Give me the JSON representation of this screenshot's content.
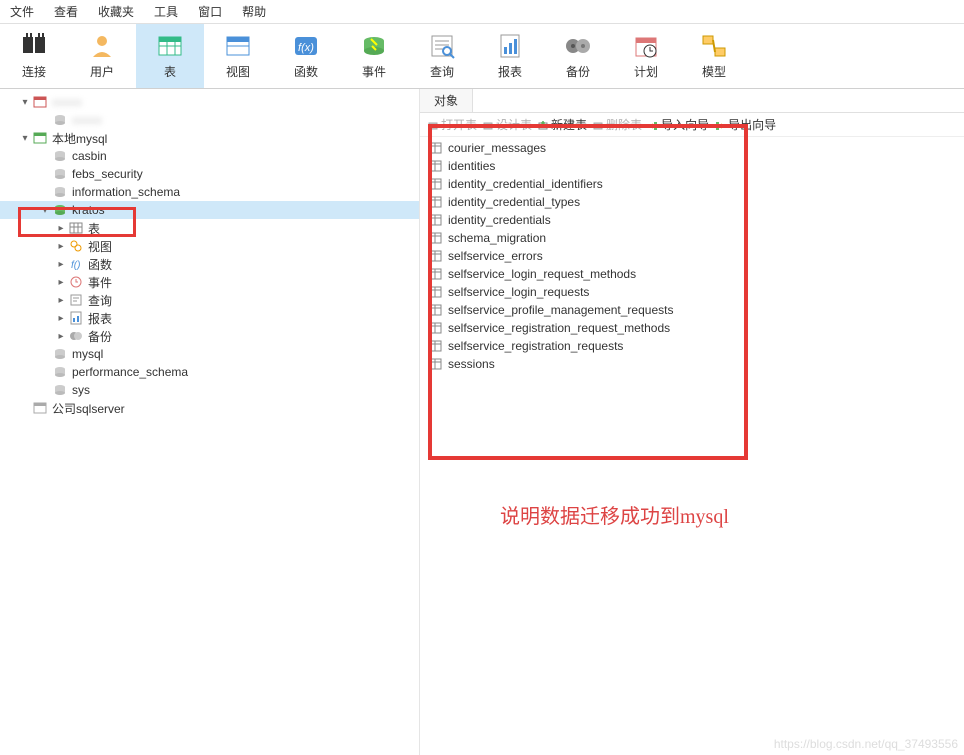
{
  "menu": [
    "文件",
    "查看",
    "收藏夹",
    "工具",
    "窗口",
    "帮助"
  ],
  "toolbar": [
    {
      "id": "connect",
      "label": "连接"
    },
    {
      "id": "user",
      "label": "用户"
    },
    {
      "id": "table",
      "label": "表",
      "active": true
    },
    {
      "id": "view",
      "label": "视图"
    },
    {
      "id": "function",
      "label": "函数"
    },
    {
      "id": "event",
      "label": "事件"
    },
    {
      "id": "query",
      "label": "查询"
    },
    {
      "id": "report",
      "label": "报表"
    },
    {
      "id": "backup",
      "label": "备份"
    },
    {
      "id": "schedule",
      "label": "计划"
    },
    {
      "id": "model",
      "label": "模型"
    }
  ],
  "sidebar": {
    "conns": [
      {
        "label": "",
        "blur": true,
        "indent": 18,
        "icon": "conn-red",
        "chev": "▾"
      },
      {
        "label": "",
        "blur": true,
        "indent": 38,
        "icon": "db-grey"
      },
      {
        "label": "本地mysql",
        "indent": 18,
        "icon": "conn-green",
        "chev": "▾"
      },
      {
        "label": "casbin",
        "indent": 38,
        "icon": "db-grey"
      },
      {
        "label": "febs_security",
        "indent": 38,
        "icon": "db-grey"
      },
      {
        "label": "information_schema",
        "indent": 38,
        "icon": "db-grey"
      },
      {
        "label": "kratos",
        "indent": 38,
        "icon": "db-green",
        "selected": true,
        "chev": "▾"
      },
      {
        "label": "表",
        "indent": 54,
        "icon": "tables",
        "chev": "▸"
      },
      {
        "label": "视图",
        "indent": 54,
        "icon": "views",
        "chev": "▸"
      },
      {
        "label": "函数",
        "indent": 54,
        "icon": "func",
        "chev": "▸"
      },
      {
        "label": "事件",
        "indent": 54,
        "icon": "event",
        "chev": "▸"
      },
      {
        "label": "查询",
        "indent": 54,
        "icon": "query",
        "chev": "▸"
      },
      {
        "label": "报表",
        "indent": 54,
        "icon": "report",
        "chev": "▸"
      },
      {
        "label": "备份",
        "indent": 54,
        "icon": "backup",
        "chev": "▸"
      },
      {
        "label": "mysql",
        "indent": 38,
        "icon": "db-grey"
      },
      {
        "label": "performance_schema",
        "indent": 38,
        "icon": "db-grey"
      },
      {
        "label": "sys",
        "indent": 38,
        "icon": "db-grey"
      },
      {
        "label": "公司sqlserver",
        "indent": 18,
        "icon": "conn-grey"
      }
    ]
  },
  "content": {
    "tab": "对象",
    "actions": {
      "open": "打开表",
      "design": "设计表",
      "new": "新建表",
      "delete": "删除表",
      "import": "导入向导",
      "export": "导出向导"
    },
    "tables": [
      "courier_messages",
      "identities",
      "identity_credential_identifiers",
      "identity_credential_types",
      "identity_credentials",
      "schema_migration",
      "selfservice_errors",
      "selfservice_login_request_methods",
      "selfservice_login_requests",
      "selfservice_profile_management_requests",
      "selfservice_registration_request_methods",
      "selfservice_registration_requests",
      "sessions"
    ]
  },
  "annotation": "说明数据迁移成功到mysql",
  "watermark": "https://blog.csdn.net/qq_37493556"
}
